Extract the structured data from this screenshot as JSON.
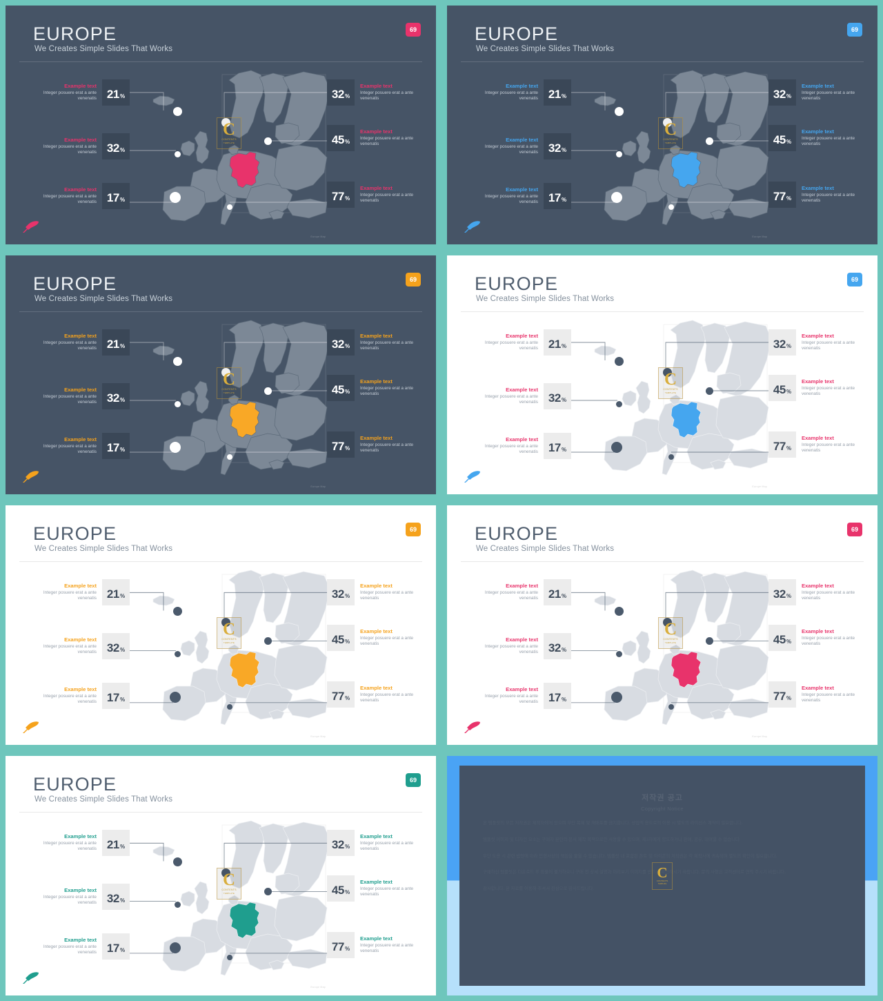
{
  "theme": {
    "separator_color": "#6ec6bc",
    "dark_bg": "#465466",
    "light_bg": "#ffffff",
    "pink": "#e8336b",
    "blue": "#45a6ef",
    "orange": "#f5a21c",
    "teal": "#1f9e8e",
    "num_box_dark": "#3a4757",
    "num_box_light": "#ececec"
  },
  "slide": {
    "title": "EUROPE",
    "subtitle": "We Creates Simple Slides That Works",
    "badge": "69",
    "map_credit": "Europe Map"
  },
  "stats": {
    "left": [
      {
        "heading": "Example text",
        "body": "Integer posuere erat a ante venenatis",
        "value": "21",
        "unit": "%"
      },
      {
        "heading": "Example text",
        "body": "Integer posuere erat a ante venenatis",
        "value": "32",
        "unit": "%"
      },
      {
        "heading": "Example text",
        "body": "Integer posuere erat a ante venenatis",
        "value": "17",
        "unit": "%"
      }
    ],
    "right": [
      {
        "heading": "Example text",
        "body": "Integer posuere erat a ante venenatis",
        "value": "32",
        "unit": "%"
      },
      {
        "heading": "Example text",
        "body": "Integer posuere erat a ante venenatis",
        "value": "45",
        "unit": "%"
      },
      {
        "heading": "Example text",
        "body": "Integer posuere erat a ante venenatis",
        "value": "77",
        "unit": "%"
      }
    ]
  },
  "watermark": {
    "letter": "C",
    "line1": "CONTENTS",
    "line2": "TEMPLATE"
  },
  "panels": [
    {
      "id": "p1",
      "mode": "dark",
      "accent": "#e8336b",
      "badge_bg": "#e8336b",
      "country_fill": "#e8336b",
      "arrow_color": "#e8336b"
    },
    {
      "id": "p2",
      "mode": "dark",
      "accent": "#45a6ef",
      "badge_bg": "#45a6ef",
      "country_fill": "#45a6ef",
      "arrow_color": "#45a6ef"
    },
    {
      "id": "p3",
      "mode": "dark",
      "accent": "#f5a21c",
      "badge_bg": "#f5a21c",
      "country_fill": "#f9a826",
      "arrow_color": "#f5a21c"
    },
    {
      "id": "p4",
      "mode": "light",
      "accent": "#e8336b",
      "badge_bg": "#45a6ef",
      "country_fill": "#45a6ef",
      "arrow_color": "#45a6ef"
    },
    {
      "id": "p5",
      "mode": "light",
      "accent": "#f5a21c",
      "badge_bg": "#f5a21c",
      "country_fill": "#f9a826",
      "arrow_color": "#f5a21c"
    },
    {
      "id": "p6",
      "mode": "light",
      "accent": "#e8336b",
      "badge_bg": "#e8336b",
      "country_fill": "#e8336b",
      "arrow_color": "#e8336b"
    },
    {
      "id": "p7",
      "mode": "light",
      "accent": "#1f9e8e",
      "badge_bg": "#1f9e8e",
      "country_fill": "#1f9e8e",
      "arrow_color": "#1f9e8e"
    }
  ],
  "copyright": {
    "title": "저작권 공고",
    "subtitle": "Copyright Notice",
    "p1": "본 템플릿의 모든 저작권은 제작자에게 있으며 무단 복제 및 재배포를 금지합니다. 상업적 용도로의 이용 시 별도의 라이선스 계약이 필요합니다.",
    "p2": "템플릿 이미지 및 디자인 요소는 구매자 본인의 문서 제작 목적으로만 사용할 수 있으며, 제3자에게 양도하거나 판매, 공유, 대여할 수 없습니다.",
    "p3": "무단 도용 시 관련 법령에 따라 민형사상의 책임을 물을 수 있습니다. 템플릿 내 포함된 폰트 및 아이콘의 저작권은 각 제작사에 귀속되며 별도의 확인이 필요합니다.",
    "p4": "구매하신 템플릿은 다운로드 후 환불이 불가하오니 구매 전 상세 설명과 미리보기 이미지를 반드시 확인하시기 바랍니다. 문의 사항은 고객센터로 연락 주시기 바랍니다.",
    "p5": "감사합니다. 본 자료를 이용해 주셔서 진심으로 감사드립니다."
  }
}
